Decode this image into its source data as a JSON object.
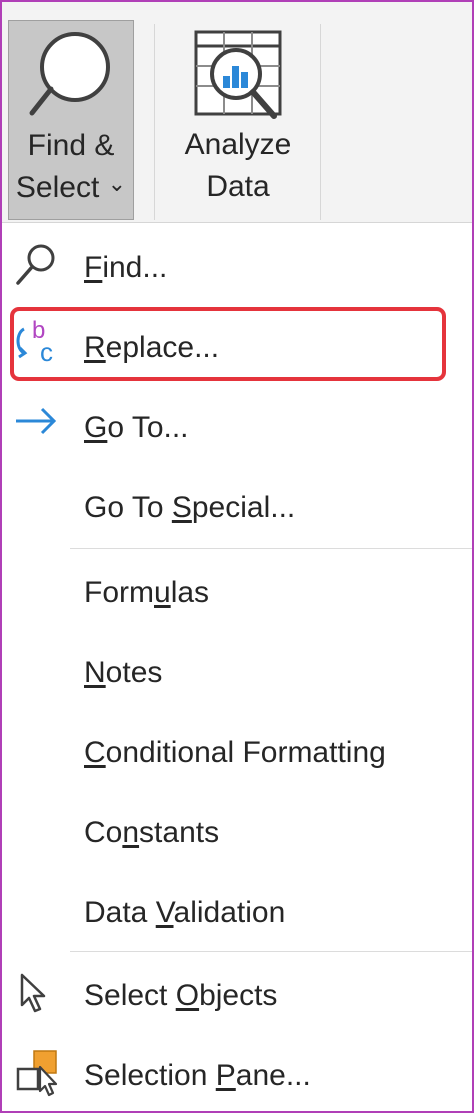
{
  "ribbon": {
    "find_select": {
      "line1": "Find &",
      "line2": "Select",
      "dropdown_glyph": "⌄"
    },
    "analyze_data": {
      "line1": "Analyze",
      "line2": "Data"
    }
  },
  "menu": {
    "items": [
      {
        "id": "find",
        "icon": "magnifier-icon",
        "label_pre": "",
        "label_key": "F",
        "label_post": "ind..."
      },
      {
        "id": "replace",
        "icon": "replace-icon",
        "label_pre": "",
        "label_key": "R",
        "label_post": "eplace..."
      },
      {
        "id": "goto",
        "icon": "arrow-right-icon",
        "label_pre": "",
        "label_key": "G",
        "label_post": "o To..."
      },
      {
        "id": "goto-special",
        "icon": "",
        "label_pre": "Go To ",
        "label_key": "S",
        "label_post": "pecial..."
      },
      {
        "id": "formulas",
        "icon": "",
        "label_pre": "Form",
        "label_key": "u",
        "label_post": "las"
      },
      {
        "id": "notes",
        "icon": "",
        "label_pre": "",
        "label_key": "N",
        "label_post": "otes"
      },
      {
        "id": "conditional-formatting",
        "icon": "",
        "label_pre": "",
        "label_key": "C",
        "label_post": "onditional Formatting"
      },
      {
        "id": "constants",
        "icon": "",
        "label_pre": "Co",
        "label_key": "n",
        "label_post": "stants"
      },
      {
        "id": "data-validation",
        "icon": "",
        "label_pre": "Data ",
        "label_key": "V",
        "label_post": "alidation"
      },
      {
        "id": "select-objects",
        "icon": "cursor-arrow-icon",
        "label_pre": "Select ",
        "label_key": "O",
        "label_post": "bjects"
      },
      {
        "id": "selection-pane",
        "icon": "selection-pane-icon",
        "label_pre": "Selection ",
        "label_key": "P",
        "label_post": "ane..."
      }
    ],
    "replace_icon_letters": {
      "top": "b",
      "bottom": "c"
    }
  },
  "colors": {
    "highlight_border": "#e5343c",
    "frame_border": "#b03fb7",
    "replace_purple": "#b146c2",
    "replace_blue": "#2b88d8",
    "arrow_blue": "#2b88d8",
    "pane_orange": "#f0a030"
  }
}
